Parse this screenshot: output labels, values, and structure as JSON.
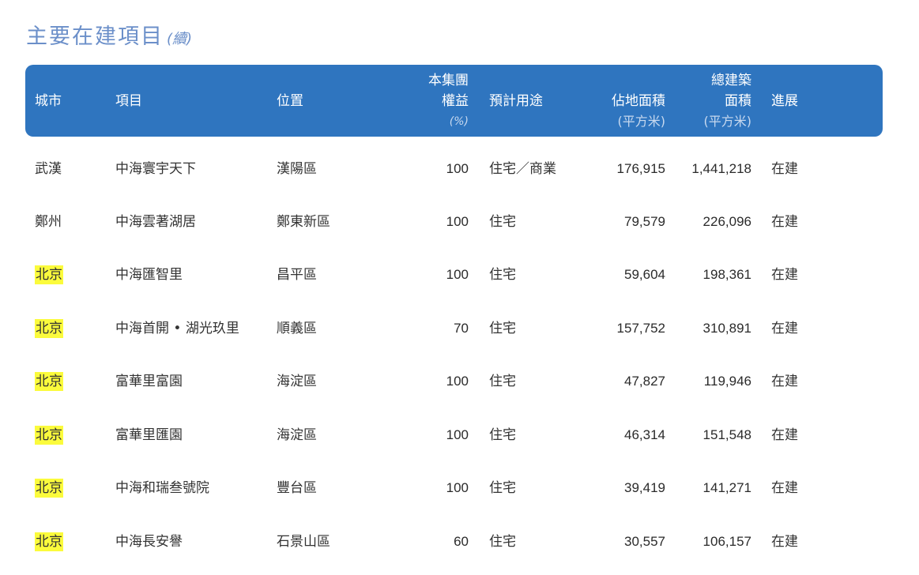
{
  "title": {
    "main": "主要在建項目",
    "suffix": "(續)"
  },
  "columns": {
    "city": "城市",
    "project": "項目",
    "location": "位置",
    "interest_line1": "本集團",
    "interest_line2": "權益",
    "interest_unit": "(%)",
    "usage": "預計用途",
    "site_area_line1": "佔地面積",
    "site_area_unit": "(平方米)",
    "gfa_line1": "總建築",
    "gfa_line2": "面積",
    "gfa_unit": "(平方米)",
    "progress": "進展"
  },
  "highlight_color": "#fbfb3c",
  "header_color": "#2f75bf",
  "rows": [
    {
      "city": "武漢",
      "highlight": false,
      "project": "中海寰宇天下",
      "location": "漢陽區",
      "interest": "100",
      "usage": "住宅／商業",
      "site_area": "176,915",
      "gfa": "1,441,218",
      "progress": "在建"
    },
    {
      "city": "鄭州",
      "highlight": false,
      "project": "中海雲著湖居",
      "location": "鄭東新區",
      "interest": "100",
      "usage": "住宅",
      "site_area": "79,579",
      "gfa": "226,096",
      "progress": "在建"
    },
    {
      "city": "北京",
      "highlight": true,
      "project": "中海匯智里",
      "location": "昌平區",
      "interest": "100",
      "usage": "住宅",
      "site_area": "59,604",
      "gfa": "198,361",
      "progress": "在建"
    },
    {
      "city": "北京",
      "highlight": true,
      "project": "中海首開 • 湖光玖里",
      "location": "順義區",
      "interest": "70",
      "usage": "住宅",
      "site_area": "157,752",
      "gfa": "310,891",
      "progress": "在建"
    },
    {
      "city": "北京",
      "highlight": true,
      "project": "富華里富園",
      "location": "海淀區",
      "interest": "100",
      "usage": "住宅",
      "site_area": "47,827",
      "gfa": "119,946",
      "progress": "在建"
    },
    {
      "city": "北京",
      "highlight": true,
      "project": "富華里匯園",
      "location": "海淀區",
      "interest": "100",
      "usage": "住宅",
      "site_area": "46,314",
      "gfa": "151,548",
      "progress": "在建"
    },
    {
      "city": "北京",
      "highlight": true,
      "project": "中海和瑞叁號院",
      "location": "豐台區",
      "interest": "100",
      "usage": "住宅",
      "site_area": "39,419",
      "gfa": "141,271",
      "progress": "在建"
    },
    {
      "city": "北京",
      "highlight": true,
      "project": "中海長安譽",
      "location": "石景山區",
      "interest": "60",
      "usage": "住宅",
      "site_area": "30,557",
      "gfa": "106,157",
      "progress": "在建"
    }
  ]
}
